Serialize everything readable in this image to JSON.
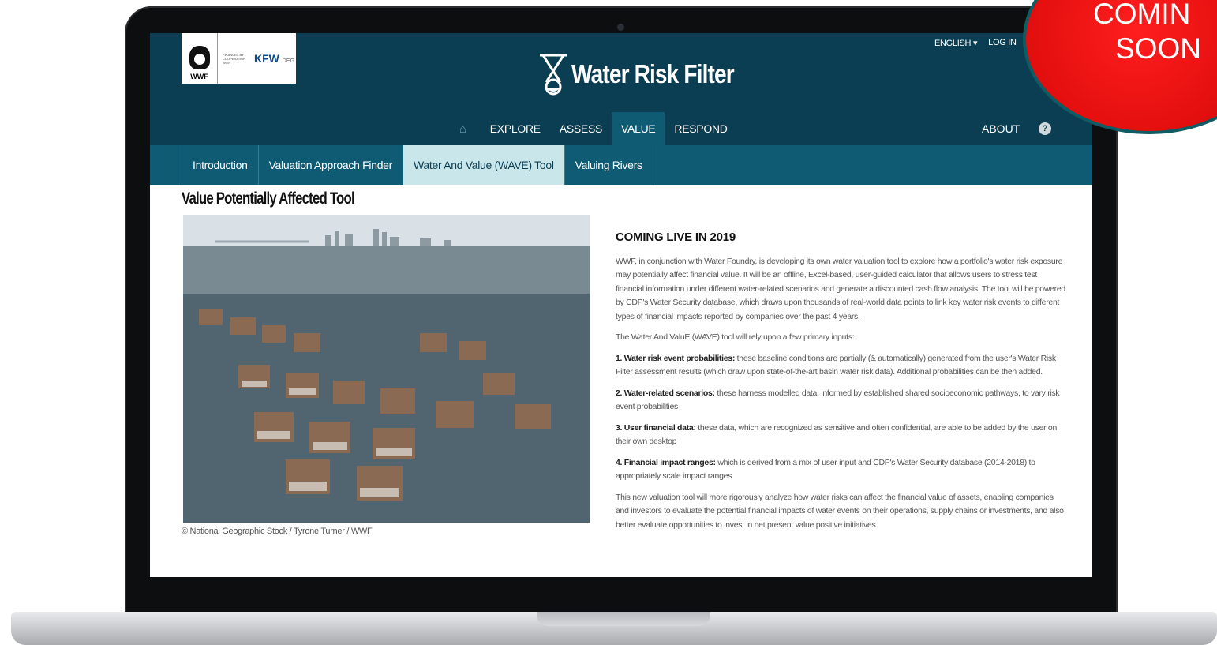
{
  "badge": {
    "line1": "COMIN",
    "line2": "SOON"
  },
  "logos": {
    "wwf": "WWF",
    "kfw": "KFW",
    "kfw_suffix": "DEG",
    "kfw_fine": "FINANCED BY COOPERATION WITH"
  },
  "brand": {
    "title": "Water Risk Filter"
  },
  "top_links": {
    "language": "ENGLISH ▾",
    "login": "LOG IN"
  },
  "main_nav": {
    "home_icon": "home-icon",
    "items": [
      {
        "label": "EXPLORE"
      },
      {
        "label": "ASSESS"
      },
      {
        "label": "VALUE",
        "active": true
      },
      {
        "label": "RESPOND"
      }
    ],
    "about": "ABOUT",
    "help": "?"
  },
  "sub_nav": {
    "tabs": [
      {
        "label": "Introduction"
      },
      {
        "label": "Valuation Approach Finder"
      },
      {
        "label": "Water And Value (WAVE) Tool",
        "active": true
      },
      {
        "label": "Valuing Rivers"
      }
    ]
  },
  "page": {
    "title": "Value Potentially Affected Tool",
    "caption": "© National Geographic Stock / Tyrone Turner / WWF"
  },
  "article": {
    "heading": "COMING LIVE IN 2019",
    "intro": "WWF, in conjunction with Water Foundry, is developing its own water valuation tool to explore how a portfolio's water risk exposure may potentially affect financial value. It will be an offline, Excel-based, user-guided calculator that allows users to stress test financial information under different water-related scenarios and generate a discounted cash flow analysis. The tool will be powered by CDP's Water Security database, which draws upon thousands of real-world data points to link key water risk events to different types of financial impacts reported by companies over the past 4 years.",
    "lead": "The Water And ValuE (WAVE) tool will rely upon a few primary inputs:",
    "inputs": [
      {
        "title": "1. Water risk event probabilities:",
        "text": " these baseline conditions are partially (& automatically) generated from the user's Water Risk Filter assessment results (which draw upon state-of-the-art basin water risk data). Additional probabilities can be then added."
      },
      {
        "title": "2. Water-related scenarios:",
        "text": " these harness modelled data, informed by established shared socioeconomic pathways, to vary risk event probabilities"
      },
      {
        "title": "3. User financial data:",
        "text": " these data, which are recognized as sensitive and often confidential, are able to be added by the user on their own desktop"
      },
      {
        "title": "4. Financial impact ranges:",
        "text": " which is derived from a mix of user input and CDP's Water Security database (2014-2018) to appropriately scale impact ranges"
      }
    ],
    "closing": "This new valuation tool will more rigorously analyze how water risks can affect the financial value of assets, enabling companies and investors to evaluate the potential financial impacts of water events on their operations, supply chains or investments, and also better evaluate opportunities to invest in net present value positive initiatives."
  }
}
